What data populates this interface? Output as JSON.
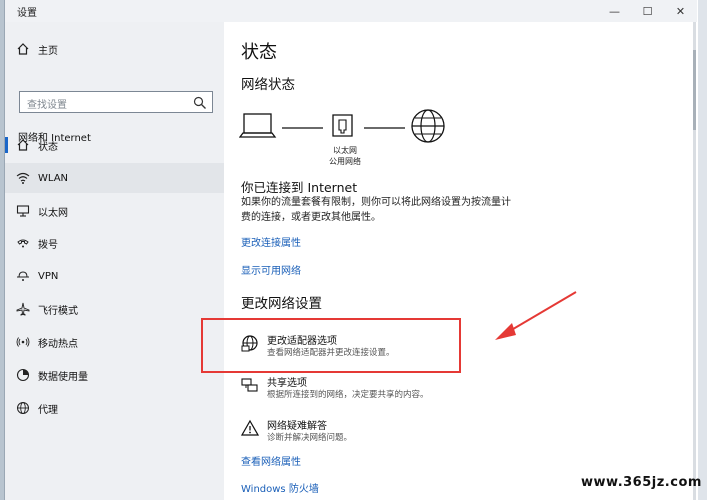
{
  "window": {
    "title": "设置",
    "min_label": "—",
    "max_label": "☐",
    "close_label": "✕"
  },
  "sidebar": {
    "home_label": "主页",
    "search_placeholder": "查找设置",
    "section_label": "网络和 Internet",
    "items": [
      {
        "label": "状态",
        "icon": "home-status-icon",
        "selected": true
      },
      {
        "label": "WLAN",
        "icon": "wifi-icon",
        "selected": false
      },
      {
        "label": "以太网",
        "icon": "ethernet-icon",
        "selected": false
      },
      {
        "label": "拨号",
        "icon": "dialup-icon",
        "selected": false
      },
      {
        "label": "VPN",
        "icon": "vpn-icon",
        "selected": false
      },
      {
        "label": "飞行模式",
        "icon": "airplane-icon",
        "selected": false
      },
      {
        "label": "移动热点",
        "icon": "hotspot-icon",
        "selected": false
      },
      {
        "label": "数据使用量",
        "icon": "data-usage-icon",
        "selected": false
      },
      {
        "label": "代理",
        "icon": "globe-icon",
        "selected": false
      }
    ]
  },
  "main": {
    "page_title": "状态",
    "network_status_heading": "网络状态",
    "diagram": {
      "label_line1": "以太网",
      "label_line2": "公用网络"
    },
    "connected_heading": "你已连接到 Internet",
    "connected_text_line1": "如果你的流量套餐有限制，则你可以将此网络设置为按流量计",
    "connected_text_line2": "费的连接，或者更改其他属性。",
    "link_change_props": "更改连接属性",
    "link_show_networks": "显示可用网络",
    "change_settings_heading": "更改网络设置",
    "options": [
      {
        "title": "更改适配器选项",
        "desc": "查看网络适配器并更改连接设置。",
        "icon": "adapter-icon"
      },
      {
        "title": "共享选项",
        "desc": "根据所连接到的网络，决定要共享的内容。",
        "icon": "sharing-icon"
      },
      {
        "title": "网络疑难解答",
        "desc": "诊断并解决网络问题。",
        "icon": "warning-icon"
      }
    ],
    "link_view_props": "查看网络属性",
    "link_firewall": "Windows 防火墙"
  },
  "annotation": {
    "box_color": "#e53935",
    "arrow_color": "#e53935"
  },
  "watermark": "www.365jz.com",
  "colors": {
    "accent": "#1a66c8",
    "link": "#1a5fb8"
  }
}
